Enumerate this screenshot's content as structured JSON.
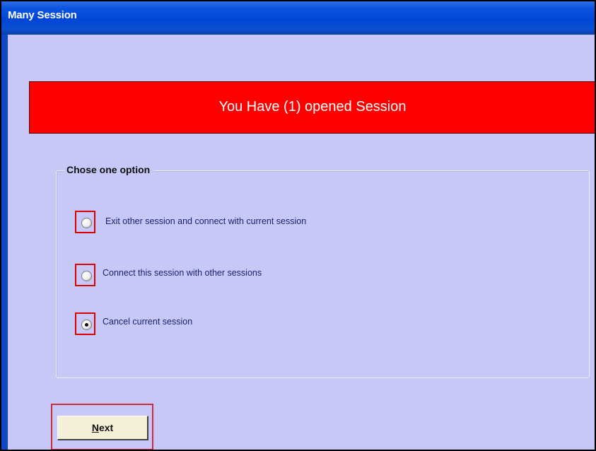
{
  "window": {
    "title": "Many Session"
  },
  "banner": {
    "message": "You Have (1) opened Session"
  },
  "group": {
    "legend": "Chose one option",
    "options": [
      {
        "label": "Exit other session and connect with current session",
        "selected": false
      },
      {
        "label": "Connect this  session with other sessions",
        "selected": false
      },
      {
        "label": "Cancel current session",
        "selected": true
      }
    ]
  },
  "actions": {
    "next_mnemonic": "N",
    "next_rest": "ext"
  },
  "colors": {
    "titlebar": "#0a4ecf",
    "banner": "#ff0000",
    "background": "#c8c8f8",
    "highlight_box": "#d90000",
    "button_face": "#f3f0d7",
    "label_text": "#18216b"
  }
}
